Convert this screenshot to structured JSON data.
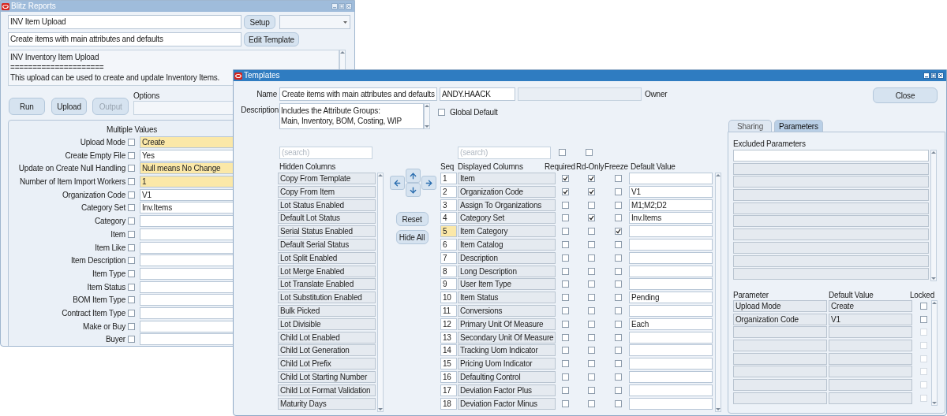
{
  "back_window": {
    "title": "Blitz Reports",
    "active": false,
    "report_name": "INV Item Upload",
    "setup_button": "Setup",
    "template": "Create items with main attributes and defaults",
    "edit_template_button": "Edit Template",
    "description_lines": [
      "INV Inventory Item Upload",
      "=====================",
      "This upload can be used to create and update Inventory Items."
    ],
    "buttons": [
      {
        "label": "Run",
        "disabled": false
      },
      {
        "label": "Upload",
        "disabled": false
      },
      {
        "label": "Output",
        "disabled": true
      }
    ],
    "options_label": "Options",
    "parameters_header": "Multiple Values",
    "parameters": [
      {
        "label": "Upload Mode",
        "value": "Create",
        "required": true,
        "checked": false
      },
      {
        "label": "Create Empty File",
        "value": "Yes",
        "required": false,
        "checked": false
      },
      {
        "label": "Update on Create Null Handling",
        "value": "Null means No Change",
        "required": true,
        "checked": false
      },
      {
        "label": "Number of Item Import Workers",
        "value": "1",
        "required": true,
        "checked": false
      },
      {
        "label": "Organization Code",
        "value": "V1",
        "required": false,
        "checked": false
      },
      {
        "label": "Category Set",
        "value": "Inv.Items",
        "required": false,
        "checked": false
      },
      {
        "label": "Category",
        "required": false,
        "checked": false
      },
      {
        "label": "Item",
        "required": false,
        "checked": false
      },
      {
        "label": "Item Like",
        "required": false,
        "checked": false
      },
      {
        "label": "Item Description",
        "required": false,
        "checked": false
      },
      {
        "label": "Item Type",
        "required": false,
        "checked": false
      },
      {
        "label": "Item Status",
        "required": false,
        "checked": false
      },
      {
        "label": "BOM Item Type",
        "required": false,
        "checked": false
      },
      {
        "label": "Contract Item Type",
        "required": false,
        "checked": false
      },
      {
        "label": "Make or Buy",
        "required": false,
        "checked": false
      },
      {
        "label": "Buyer",
        "required": false,
        "checked": false
      }
    ]
  },
  "templates_window": {
    "title": "Templates",
    "active": true,
    "name_label": "Name",
    "name": "Create items with main attributes and defaults",
    "owner": "ANDY.HAACK",
    "owner_label": "Owner",
    "close_button": "Close",
    "description_label": "Description",
    "description_lines": [
      "Includes the Attribute Groups:",
      "Main, Inventory, BOM, Costing, WIP"
    ],
    "global_default": {
      "label": "Global Default",
      "checked": false
    },
    "hidden_search_placeholder": "(search)",
    "displayed_search_placeholder": "(search)",
    "required_all_checked": false,
    "read_only_all_checked": false,
    "hidden_columns_header": "Hidden Columns",
    "hidden_columns": [
      "Copy From Template",
      "Copy From Item",
      "Lot Status Enabled",
      "Default Lot Status",
      "Serial Status Enabled",
      "Default Serial Status",
      "Lot Split Enabled",
      "Lot Merge Enabled",
      "Lot Translate Enabled",
      "Lot Substitution Enabled",
      "Bulk Picked",
      "Lot Divisible",
      "Child Lot Enabled",
      "Child Lot Generation",
      "Child Lot Prefix",
      "Child Lot Starting Number",
      "Child Lot Format Validation",
      "Maturity Days"
    ],
    "reset_button": "Reset",
    "hide_all_button": "Hide All",
    "displayed_headers": {
      "seq": "Seq",
      "column": "Displayed Columns",
      "required": "Required",
      "read_only": "Rd-Only",
      "freeze": "Freeze",
      "default_value": "Default Value"
    },
    "displayed_columns": [
      {
        "seq": "1",
        "name": "Item",
        "required": true,
        "read_only": true,
        "freeze": false,
        "selected": false
      },
      {
        "seq": "2",
        "name": "Organization Code",
        "required": true,
        "read_only": true,
        "freeze": false,
        "default_value": "V1",
        "selected": false
      },
      {
        "seq": "3",
        "name": "Assign To Organizations",
        "required": false,
        "read_only": false,
        "freeze": false,
        "default_value": "M1;M2;D2",
        "selected": false
      },
      {
        "seq": "4",
        "name": "Category Set",
        "required": false,
        "read_only": true,
        "freeze": false,
        "default_value": "Inv.Items",
        "selected": false
      },
      {
        "seq": "5",
        "name": "Item Category",
        "required": false,
        "read_only": false,
        "freeze": true,
        "selected": true
      },
      {
        "seq": "6",
        "name": "Item Catalog",
        "required": false,
        "read_only": false,
        "freeze": false,
        "selected": false
      },
      {
        "seq": "7",
        "name": "Description",
        "required": false,
        "read_only": false,
        "freeze": false,
        "selected": false
      },
      {
        "seq": "8",
        "name": "Long Description",
        "required": false,
        "read_only": false,
        "freeze": false,
        "selected": false
      },
      {
        "seq": "9",
        "name": "User Item Type",
        "required": false,
        "read_only": false,
        "freeze": false,
        "selected": false
      },
      {
        "seq": "10",
        "name": "Item Status",
        "required": false,
        "read_only": false,
        "freeze": false,
        "default_value": "Pending",
        "selected": false
      },
      {
        "seq": "11",
        "name": "Conversions",
        "required": false,
        "read_only": false,
        "freeze": false,
        "selected": false
      },
      {
        "seq": "12",
        "name": "Primary Unit Of Measure",
        "required": false,
        "read_only": false,
        "freeze": false,
        "default_value": "Each",
        "selected": false
      },
      {
        "seq": "13",
        "name": "Secondary Unit Of Measure",
        "required": false,
        "read_only": false,
        "freeze": false,
        "selected": false
      },
      {
        "seq": "14",
        "name": "Tracking Uom Indicator",
        "required": false,
        "read_only": false,
        "freeze": false,
        "selected": false
      },
      {
        "seq": "15",
        "name": "Pricing Uom Indicator",
        "required": false,
        "read_only": false,
        "freeze": false,
        "selected": false
      },
      {
        "seq": "16",
        "name": "Defaulting Control",
        "required": false,
        "read_only": false,
        "freeze": false,
        "selected": false
      },
      {
        "seq": "17",
        "name": "Deviation Factor Plus",
        "required": false,
        "read_only": false,
        "freeze": false,
        "selected": false
      },
      {
        "seq": "18",
        "name": "Deviation Factor Minus",
        "required": false,
        "read_only": false,
        "freeze": false,
        "selected": false
      }
    ],
    "tabs": [
      {
        "label": "Sharing",
        "selected": false
      },
      {
        "label": "Parameters",
        "selected": true
      }
    ],
    "excluded_parameters_label": "Excluded Parameters",
    "excluded_parameters": [
      {
        "selected": true
      },
      {
        "selected": false
      },
      {
        "selected": false
      },
      {
        "selected": false
      },
      {
        "selected": false
      },
      {
        "selected": false
      },
      {
        "selected": false
      },
      {
        "selected": false
      },
      {
        "selected": false
      },
      {
        "selected": false
      }
    ],
    "parameter_headers": {
      "parameter": "Parameter",
      "default_value": "Default Value",
      "locked": "Locked"
    },
    "parameters": [
      {
        "name": "Upload Mode",
        "default_value": "Create",
        "locked": false,
        "disabled": false
      },
      {
        "name": "Organization Code",
        "default_value": "V1",
        "locked": false,
        "disabled": false
      },
      {
        "locked": false,
        "disabled": true
      },
      {
        "locked": false,
        "disabled": true
      },
      {
        "locked": false,
        "disabled": true
      },
      {
        "locked": false,
        "disabled": true
      },
      {
        "locked": false,
        "disabled": true
      },
      {
        "locked": false,
        "disabled": true
      }
    ]
  }
}
